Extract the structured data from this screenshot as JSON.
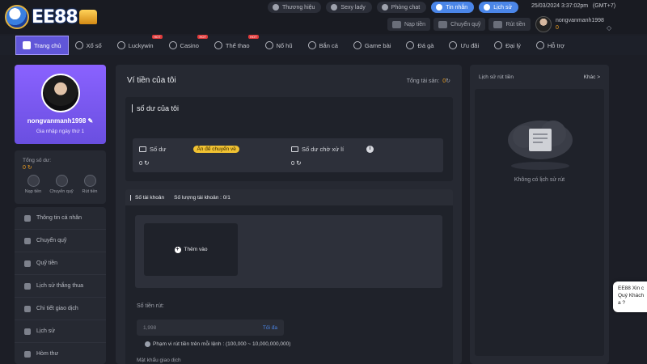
{
  "brand": {
    "logo_text": "EE88"
  },
  "header": {
    "links": [
      {
        "label": "Thương hiệu",
        "icon": "car-icon"
      },
      {
        "label": "Sexy lady",
        "icon": "play-icon"
      },
      {
        "label": "Phòng chat",
        "icon": "chat-icon"
      },
      {
        "label": "Tin nhắn",
        "icon": "message-icon",
        "highlight": true
      },
      {
        "label": "Lịch sử",
        "icon": "history-icon",
        "highlight": true
      }
    ],
    "datetime": "25/03/2024 3:37:02pm",
    "timezone": "(GMT+7)",
    "actions": [
      "Nạp tiền",
      "Chuyển quỹ",
      "Rút tiền"
    ],
    "username": "nongvanmanh1998",
    "balance": "0"
  },
  "nav": [
    {
      "label": "Trang chủ",
      "icon": "home-icon",
      "active": true
    },
    {
      "label": "Xổ số",
      "icon": "lottery-icon"
    },
    {
      "label": "Luckywin",
      "icon": "luckywin-icon",
      "hot": true
    },
    {
      "label": "Casino",
      "icon": "casino-icon",
      "hot": true
    },
    {
      "label": "Thể thao",
      "icon": "sports-icon",
      "hot": true
    },
    {
      "label": "Nổ hũ",
      "icon": "slot-icon"
    },
    {
      "label": "Bắn cá",
      "icon": "fish-icon"
    },
    {
      "label": "Game bài",
      "icon": "cards-icon"
    },
    {
      "label": "Đá gà",
      "icon": "rooster-icon"
    },
    {
      "label": "Ưu đãi",
      "icon": "gift-icon"
    },
    {
      "label": "Đại lý",
      "icon": "agent-icon"
    },
    {
      "label": "Hỗ trợ",
      "icon": "support-icon"
    }
  ],
  "hot_label": "HOT",
  "profile": {
    "name": "nongvanmanh1998",
    "joined": "Gia nhập ngày thứ 1"
  },
  "balance_card": {
    "label": "Tổng số dư:",
    "value": "0",
    "actions": [
      "Nạp tiền",
      "Chuyển quỹ",
      "Rút tiền"
    ]
  },
  "side_menu": [
    "Thông tin cá nhân",
    "Chuyển quỹ",
    "Quỹ tiền",
    "Lịch sử thắng thua",
    "Chi tiết giao dịch",
    "Lịch sử",
    "Hòm thư"
  ],
  "wallet": {
    "title": "Ví tiền của tôi",
    "total_assets_label": "Tổng tài sản:",
    "total_assets_value": "0",
    "my_balance_title": "số dư của tôi",
    "balance_label": "Số dư",
    "hide_tag": "Ẩn để chuyển về",
    "balance_value": "0",
    "pending_label": "Số dư chờ xử lí",
    "pending_value": "0",
    "accounts_label": "Số tài khoản",
    "accounts_count_label": "Số lượng tài khoản : 0/1",
    "add_label": "Thêm vào",
    "withdraw_label": "Số tiền rút:",
    "amount_placeholder": "1,998",
    "max_label": "Tối đa",
    "range_note": "Phạm vi rút tiền trên mỗi lệnh : (100,000 ~ 10,000,000,000)",
    "tx_password_label": "Mật khẩu giao dịch"
  },
  "history": {
    "title": "Lịch sử rút tiền",
    "more": "Khác >",
    "empty": "Không có lịch sử rút"
  },
  "chat": {
    "line1": "EE88 Xin c",
    "line2": "Quý Khách",
    "line3": "a ?"
  }
}
